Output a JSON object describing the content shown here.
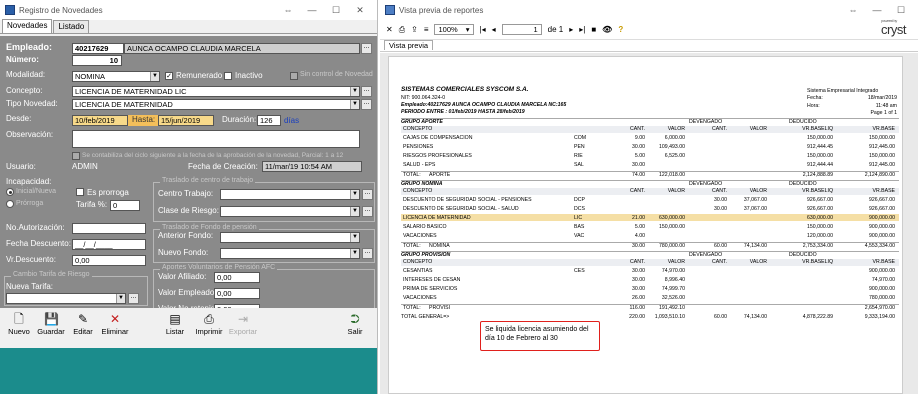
{
  "left": {
    "title": "Registro de Novedades",
    "tabs": [
      "Novedades",
      "Listado"
    ],
    "labels": {
      "empleado": "Empleado:",
      "numero": "Número:",
      "modalidad": "Modalidad:",
      "concepto": "Concepto:",
      "tipo_novedad": "Tipo Novedad:",
      "desde": "Desde:",
      "hasta": "Hasta:",
      "duracion": "Duración:",
      "dias": "días",
      "observacion": "Observación:",
      "usuario": "Usuario:",
      "fecha_creacion": "Fecha de Creación:",
      "incapacidad": "Incapacidad:",
      "inicial": "Inicial/Nueva",
      "prorroga_radio": "Prórroga",
      "es_prorroga": "Es prorroga",
      "tarifa": "Tarifa %:",
      "no_autorizacion": "No.Autorización:",
      "fecha_descuento": "Fecha Descuento:",
      "vr_descuento": "Vr.Descuento:",
      "centro_trabajo": "Centro Trabajo:",
      "clase_riesgo": "Clase de Riesgo:",
      "anterior_fondo": "Anterior Fondo:",
      "nuevo_fondo": "Nuevo Fondo:",
      "valor_afiliado": "Valor Afiliado:",
      "valor_empleador": "Valor Empleador:",
      "valor_no_retenido": "Valor No retenido:",
      "nueva_tarifa": "Nueva Tarifa:",
      "remunerado": "Remunerado",
      "inactivo": "Inactivo",
      "sin_control": "Sin control de Novedad",
      "parcial_text": "Se contabiliza del ciclo siguiente a la fecha de la aprobación de la novedad, Parcial: 1 a 12",
      "grp_riesgo": "Traslado de centro de trabajo",
      "grp_fondo": "Traslado de Fondo de pensión",
      "grp_aportes": "Aportes Voluntarios de Pensión AFC",
      "grp_tarifa": "Cambio Tarifa de Riesgo"
    },
    "values": {
      "empleado_id": "40217629",
      "empleado_nombre": "AUNCA OCAMPO CLAUDIA MARCELA",
      "numero": "10",
      "modalidad": "NOMINA",
      "concepto": "LICENCIA DE MATERNIDAD LIC",
      "tipo_novedad": "LICENCIA DE MATERNIDAD",
      "desde": "10/feb/2019",
      "hasta": "15/jun/2019",
      "duracion": "126",
      "usuario": "ADMIN",
      "fecha_creacion": "11/mar/19 10:54 AM",
      "tarifa": "0",
      "fecha_descuento": "__/__/____",
      "vr_descuento": "0,00",
      "valor_afiliado": "0,00",
      "valor_empleador": "0,00",
      "valor_no_retenido": "0,00"
    },
    "toolbar": [
      "Nuevo",
      "Guardar",
      "Editar",
      "Eliminar",
      "Listar",
      "Imprimir",
      "Exportar",
      "Salir"
    ]
  },
  "right": {
    "title": "Vista previa de reportes",
    "zoom": "100%",
    "page_current": "1",
    "page_of": "de 1",
    "tab": "Vista previa",
    "logo": "cryst",
    "logo_small": "powered by",
    "report": {
      "company": "SISTEMAS COMERCIALES SYSCOM S.A.",
      "nit": "NIT: 900.064.324-0",
      "employee_line": "Empleado:40217629 AUNCA OCAMPO CLAUDIA MARCELA NC:165",
      "period": "PERIODO ENTRE : 01/feb/2019 HASTA 28/feb/2019",
      "system": "Sistema Empresarial Integrado",
      "fecha_label": "Fecha:",
      "fecha": "18/mar/2019",
      "hora_label": "Hora:",
      "hora": "11:48 am",
      "page": "Page 1 of 1",
      "col_devengado": "DEVENGADO",
      "col_deducido": "DEDUCIDO",
      "columns": [
        "CONCEPTO",
        "CANT.",
        "VALOR",
        "CANT.",
        "VALOR",
        "VR.BASELIQ",
        "VR.BASE"
      ],
      "groups": [
        {
          "name": "GRUPO APORTE",
          "rows": [
            {
              "c": "CAJAS DE COMPENSACION",
              "code": "COM",
              "q": "9.00",
              "v": "6,000.00",
              "dq": "",
              "dv": "",
              "bl": "150,000.00",
              "b": "150,000.00"
            },
            {
              "c": "PENSIONES",
              "code": "PEN",
              "q": "30.00",
              "v": "109,493.00",
              "dq": "",
              "dv": "",
              "bl": "912,444.45",
              "b": "912,445.00"
            },
            {
              "c": "RIESGOS PROFESIONALES",
              "code": "RIE",
              "q": "5.00",
              "v": "6,525.00",
              "dq": "",
              "dv": "",
              "bl": "150,000.00",
              "b": "150,000.00"
            },
            {
              "c": "SALUD - EPS",
              "code": "SAL",
              "q": "30.00",
              "v": "",
              "dq": "",
              "dv": "",
              "bl": "912,444.44",
              "b": "912,445.00"
            }
          ],
          "total": {
            "label": "TOTAL:",
            "name": "APORTE",
            "q": "74.00",
            "v": "122,018.00",
            "dq": "",
            "dv": "",
            "bl": "2,124,888.89",
            "b": "2,124,890.00"
          }
        },
        {
          "name": "GRUPO NOMINA",
          "rows": [
            {
              "c": "DESCUENTO DE SEGURIDAD SOCIAL - PENSIONES",
              "code": "DCP",
              "q": "",
              "v": "",
              "dq": "30.00",
              "dv": "37,067.00",
              "bl": "926,667.00",
              "b": "926,667.00"
            },
            {
              "c": "DESCUENTO DE SEGURIDAD SOCIAL - SALUD",
              "code": "DCS",
              "q": "",
              "v": "",
              "dq": "30.00",
              "dv": "37,067.00",
              "bl": "926,667.00",
              "b": "926,667.00"
            },
            {
              "c": "LICENCIA DE MATERNIDAD",
              "code": "LIC",
              "q": "21.00",
              "v": "630,000.00",
              "dq": "",
              "dv": "",
              "bl": "630,000.00",
              "b": "900,000.00",
              "hl": true
            },
            {
              "c": "SALARIO BASICO",
              "code": "BAS",
              "q": "5.00",
              "v": "150,000.00",
              "dq": "",
              "dv": "",
              "bl": "150,000.00",
              "b": "900,000.00"
            },
            {
              "c": "VACACIONES",
              "code": "VAC",
              "q": "4.00",
              "v": "",
              "dq": "",
              "dv": "",
              "bl": "120,000.00",
              "b": "900,000.00"
            }
          ],
          "total": {
            "label": "TOTAL:",
            "name": "NOMINA",
            "q": "30.00",
            "v": "780,000.00",
            "dq": "60.00",
            "dv": "74,134.00",
            "bl": "2,753,334.00",
            "b": "4,553,334.00"
          }
        },
        {
          "name": "GRUPO PROVISION",
          "rows": [
            {
              "c": "CESANTIAS",
              "code": "CES",
              "q": "30.00",
              "v": "74,970.00",
              "dq": "",
              "dv": "",
              "bl": "",
              "b": "900,000.00"
            },
            {
              "c": "INTERESES DE CESAN",
              "code": "",
              "q": "30.00",
              "v": "8,996.40",
              "dq": "",
              "dv": "",
              "bl": "",
              "b": "74,970.00"
            },
            {
              "c": "PRIMA DE SERVICIOS",
              "code": "",
              "q": "30.00",
              "v": "74,999.70",
              "dq": "",
              "dv": "",
              "bl": "",
              "b": "900,000.00"
            },
            {
              "c": "VACACIONES",
              "code": "",
              "q": "26.00",
              "v": "32,526.00",
              "dq": "",
              "dv": "",
              "bl": "",
              "b": "780,000.00"
            }
          ],
          "total": {
            "label": "TOTAL:",
            "name": "PROVISI",
            "q": "116.00",
            "v": "191,492.10",
            "dq": "",
            "dv": "",
            "bl": "",
            "b": "2,654,970.00"
          }
        }
      ],
      "grand_total": {
        "label": "TOTAL GENERAL=>",
        "q": "220.00",
        "v": "1,093,510.10",
        "dq": "60.00",
        "dv": "74,134.00",
        "bl": "4,878,222.89",
        "b": "9,333,194.00"
      },
      "callout": "Se liquida licencia asumiendo del día 10 de Febrero al 30"
    }
  }
}
